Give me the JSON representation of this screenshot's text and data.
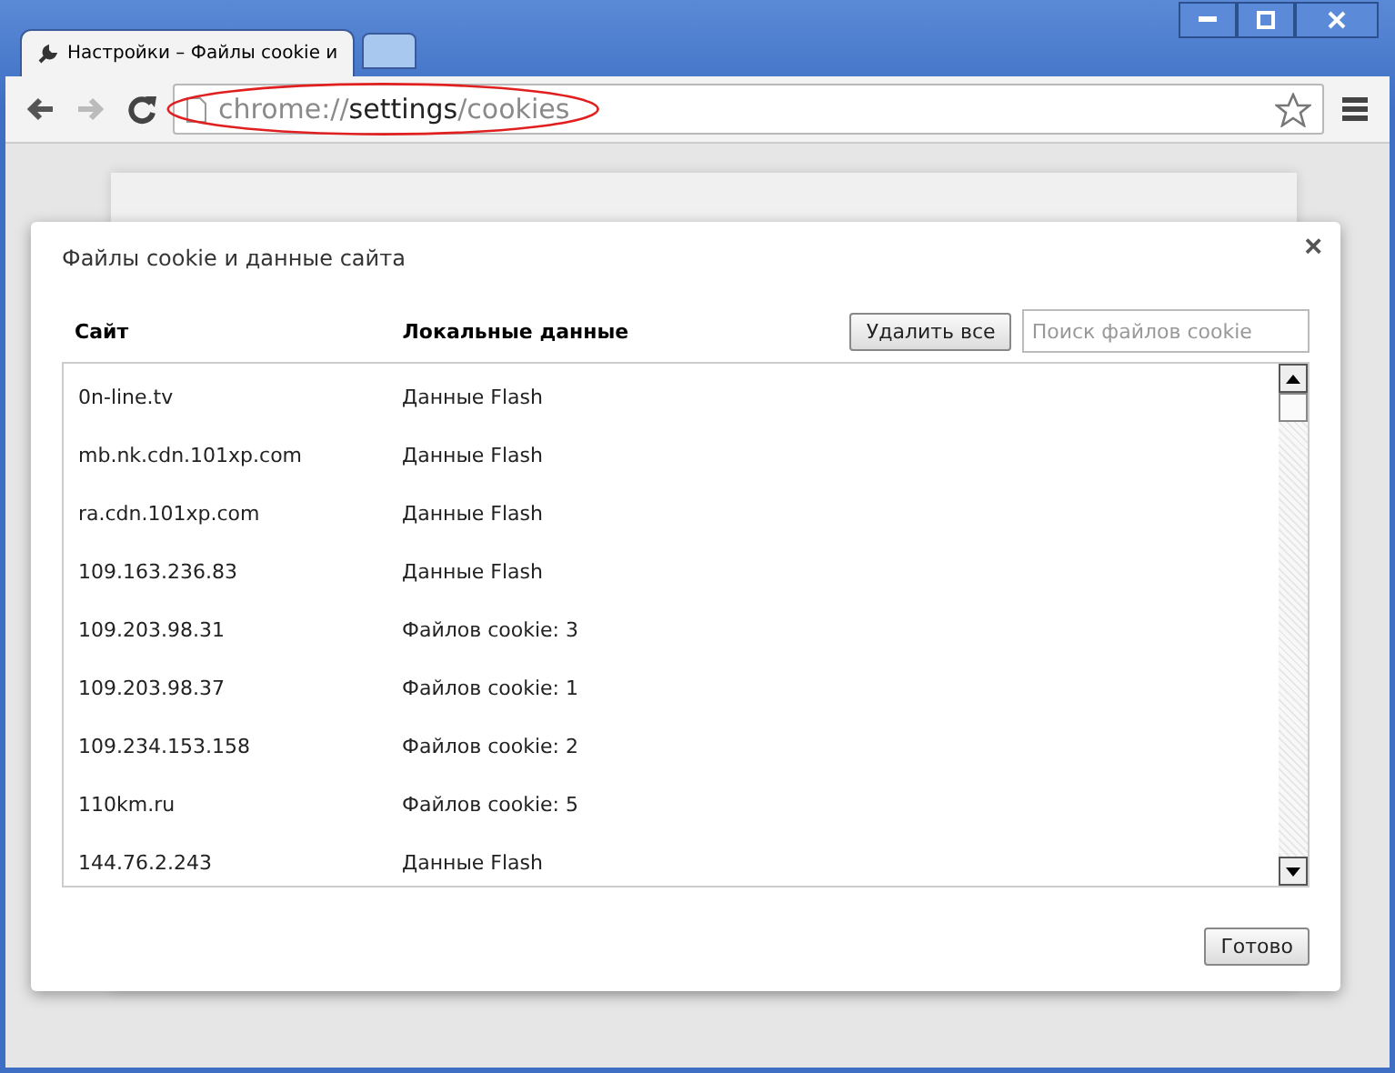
{
  "window": {
    "tabs": [
      {
        "title": "Настройки – Файлы cookie и",
        "selected": true
      }
    ],
    "new_tab_button": true
  },
  "toolbar": {
    "url": {
      "scheme": "chrome://",
      "host": "settings",
      "path": "/cookies"
    },
    "back_disabled": false,
    "forward_disabled": true,
    "url_highlighted": true
  },
  "dialog": {
    "title": "Файлы cookie и данные сайта",
    "close": "×",
    "columns": [
      "Сайт",
      "Локальные данные"
    ],
    "remove_all": "Удалить все",
    "search": {
      "placeholder": "Поиск файлов cookie"
    },
    "rows": [
      {
        "site": "0n-line.tv",
        "data": "Данные Flash"
      },
      {
        "site": "mb.nk.cdn.101xp.com",
        "data": "Данные Flash"
      },
      {
        "site": "ra.cdn.101xp.com",
        "data": "Данные Flash"
      },
      {
        "site": "109.163.236.83",
        "data": "Данные Flash"
      },
      {
        "site": "109.203.98.31",
        "data": "Файлов cookie: 3"
      },
      {
        "site": "109.203.98.37",
        "data": "Файлов cookie: 1"
      },
      {
        "site": "109.234.153.158",
        "data": "Файлов cookie: 2"
      },
      {
        "site": "110km.ru",
        "data": "Файлов cookie: 5"
      },
      {
        "site": "144.76.2.243",
        "data": "Данные Flash"
      }
    ],
    "done": "Готово"
  }
}
